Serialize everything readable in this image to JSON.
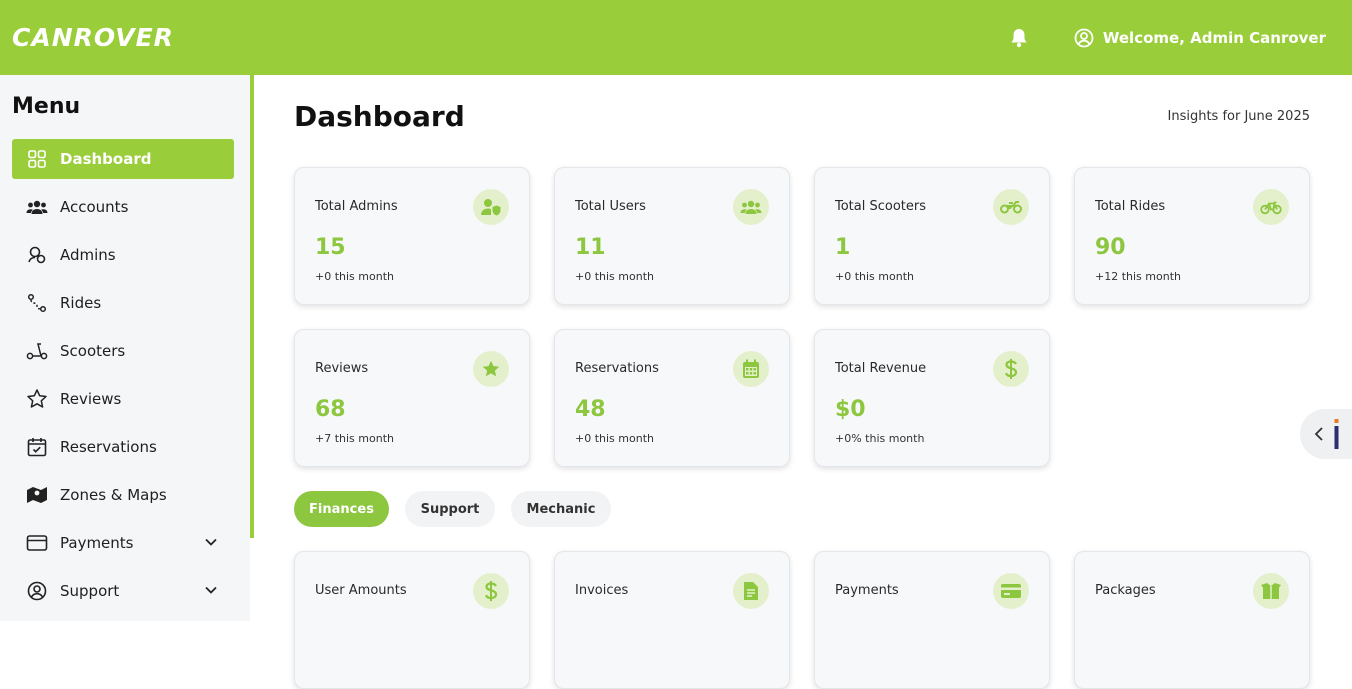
{
  "header": {
    "logo_text": "CANROVER",
    "welcome_text": "Welcome, Admin Canrover",
    "accent_color": "#9acd3a"
  },
  "sidebar": {
    "title": "Menu",
    "items": [
      {
        "label": "Dashboard",
        "icon": "grid-icon",
        "active": true
      },
      {
        "label": "Accounts",
        "icon": "users-icon"
      },
      {
        "label": "Admins",
        "icon": "admin-icon"
      },
      {
        "label": "Rides",
        "icon": "route-icon"
      },
      {
        "label": "Scooters",
        "icon": "scooter-icon"
      },
      {
        "label": "Reviews",
        "icon": "star-icon"
      },
      {
        "label": "Reservations",
        "icon": "calendar-check-icon"
      },
      {
        "label": "Zones & Maps",
        "icon": "map-icon"
      },
      {
        "label": "Payments",
        "icon": "card-icon",
        "expandable": true
      },
      {
        "label": "Support",
        "icon": "support-icon",
        "expandable": true
      }
    ]
  },
  "main": {
    "title": "Dashboard",
    "insights": "Insights for June 2025",
    "stats": [
      {
        "label": "Total Admins",
        "value": "15",
        "sub": "+0 this month",
        "icon": "admin-shield-icon"
      },
      {
        "label": "Total Users",
        "value": "11",
        "sub": "+0 this month",
        "icon": "users-icon"
      },
      {
        "label": "Total Scooters",
        "value": "1",
        "sub": "+0 this month",
        "icon": "motorcycle-icon"
      },
      {
        "label": "Total Rides",
        "value": "90",
        "sub": "+12 this month",
        "icon": "bicycle-icon"
      },
      {
        "label": "Reviews",
        "value": "68",
        "sub": "+7 this month",
        "icon": "star-icon"
      },
      {
        "label": "Reservations",
        "value": "48",
        "sub": "+0 this month",
        "icon": "calendar-icon"
      },
      {
        "label": "Total Revenue",
        "value": "$0",
        "sub": "+0% this month",
        "icon": "dollar-icon"
      }
    ],
    "tabs": [
      {
        "label": "Finances",
        "active": true
      },
      {
        "label": "Support"
      },
      {
        "label": "Mechanic"
      }
    ],
    "finance_cards": [
      {
        "label": "User Amounts",
        "icon": "dollar-icon"
      },
      {
        "label": "Invoices",
        "icon": "invoice-icon"
      },
      {
        "label": "Payments",
        "icon": "credit-card-icon"
      },
      {
        "label": "Packages",
        "icon": "package-icon"
      }
    ]
  }
}
